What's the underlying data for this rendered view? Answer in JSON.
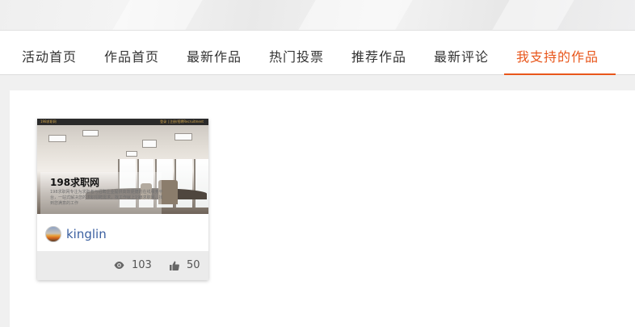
{
  "nav": {
    "items": [
      {
        "label": "活动首页",
        "active": false
      },
      {
        "label": "作品首页",
        "active": false
      },
      {
        "label": "最新作品",
        "active": false
      },
      {
        "label": "热门投票",
        "active": false
      },
      {
        "label": "推荐作品",
        "active": false
      },
      {
        "label": "最新评论",
        "active": false
      },
      {
        "label": "我支持的作品",
        "active": true
      }
    ],
    "accent_color": "#e8561b"
  },
  "works": [
    {
      "thumbnail": {
        "header_left": "198求职网",
        "header_right": "登录 | 注册/招聘Recruitment",
        "title": "198求职网",
        "description": "198求职网专注为求职者与招聘企业提供高效便捷的在线服务平台，一站式解决您的求职招聘需求，找工作就上198求职网，找到您满意的工作"
      },
      "author": "kinglin",
      "views": "103",
      "likes": "50",
      "icons": {
        "views": "eye-icon",
        "likes": "thumbs-up-icon"
      }
    }
  ]
}
